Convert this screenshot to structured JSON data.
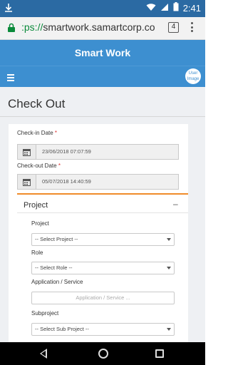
{
  "status_bar": {
    "time": "2:41"
  },
  "browser": {
    "url_scheme": ":ps://",
    "url_rest": "smartwork.samartcorp.com/(",
    "tab_count": "4"
  },
  "app": {
    "title": "Smart Work",
    "avatar_text": "User Image"
  },
  "page": {
    "title": "Check Out",
    "checkin": {
      "label": "Check-in Date",
      "value": "23/06/2018 07:07:59"
    },
    "checkout": {
      "label": "Check-out Date",
      "value": "05/07/2018 14:40:59"
    }
  },
  "project_section": {
    "title": "Project",
    "collapse_symbol": "–",
    "fields": {
      "project": {
        "label": "Project",
        "value": "-- Select Project --"
      },
      "role": {
        "label": "Role",
        "value": "-- Select Role --"
      },
      "application": {
        "label": "Application / Service",
        "placeholder": "Application / Service ..."
      },
      "subproject": {
        "label": "Subproject",
        "value": "-- Select Sub Project --"
      }
    }
  },
  "required_marker": "*",
  "colors": {
    "status_bar": "#2b6aa3",
    "app_header": "#3d8fd0",
    "accent_orange": "#f08c2a",
    "content_bg": "#eef0f3"
  }
}
